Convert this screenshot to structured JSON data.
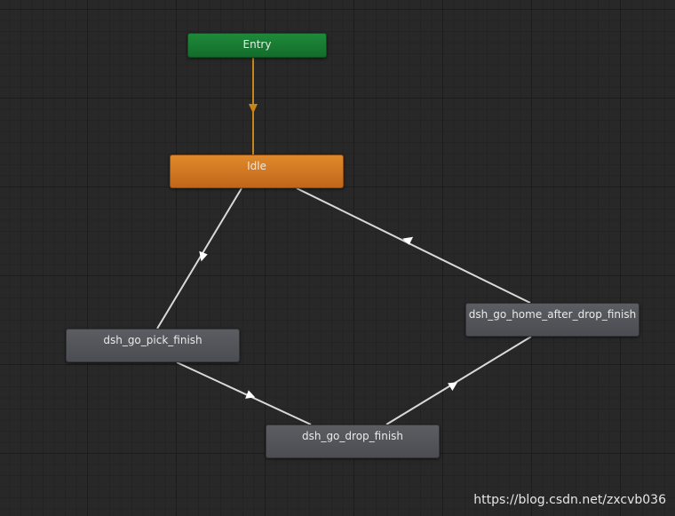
{
  "graph": {
    "nodes": {
      "entry": {
        "label": "Entry",
        "color": "#1e8a3a"
      },
      "idle": {
        "label": "Idle",
        "color": "#d07a24"
      },
      "pick": {
        "label": "dsh_go_pick_finish",
        "color": "#55575c"
      },
      "drop": {
        "label": "dsh_go_drop_finish",
        "color": "#55575c"
      },
      "home": {
        "label": "dsh_go_home_after_drop_finish",
        "color": "#55575c"
      }
    },
    "transitions": [
      {
        "from": "Entry",
        "to": "Idle",
        "color": "#c8861a"
      },
      {
        "from": "Idle",
        "to": "dsh_go_pick_finish",
        "color": "#d9d9d9"
      },
      {
        "from": "dsh_go_pick_finish",
        "to": "dsh_go_drop_finish",
        "color": "#d9d9d9"
      },
      {
        "from": "dsh_go_drop_finish",
        "to": "dsh_go_home_after_drop_finish",
        "color": "#d9d9d9"
      },
      {
        "from": "dsh_go_home_after_drop_finish",
        "to": "Idle",
        "color": "#d9d9d9"
      }
    ]
  },
  "watermark": "https://blog.csdn.net/zxcvb036"
}
